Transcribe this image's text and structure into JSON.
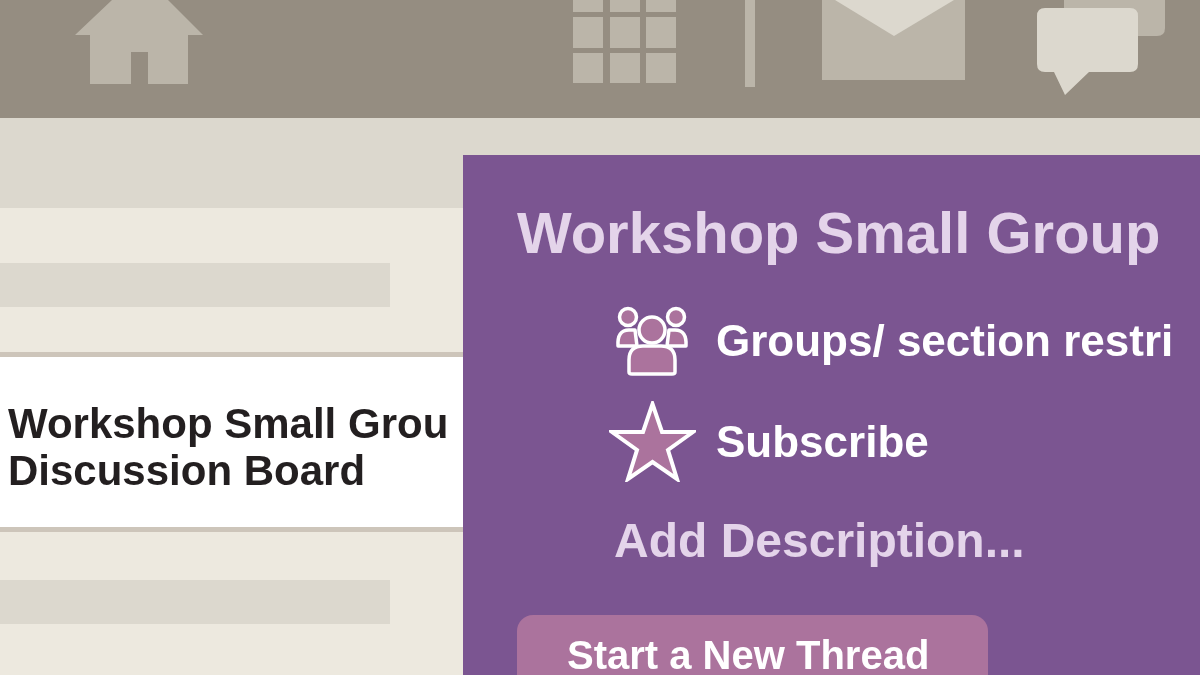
{
  "board_card": {
    "title_lines": [
      "Workshop Small Grou",
      "Discussion Board"
    ]
  },
  "forum_panel": {
    "title": "Workshop Small Group",
    "options": [
      {
        "kind": "groups",
        "label": "Groups/ section restri"
      },
      {
        "kind": "subscribe",
        "label": "Subscribe"
      }
    ],
    "description_link": "Add Description...",
    "primary_button": "Start a New Thread"
  }
}
